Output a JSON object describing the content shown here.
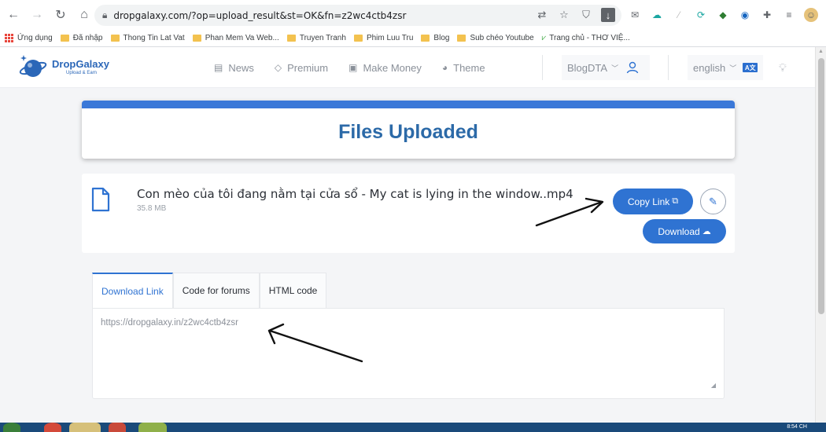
{
  "browser": {
    "url": "dropgalaxy.com/?op=upload_result&st=OK&fn=z2wc4ctb4zsr",
    "bookmarks": [
      {
        "label": "Ứng dụng",
        "kind": "apps"
      },
      {
        "label": "Đã nhập",
        "kind": "folder"
      },
      {
        "label": "Thong Tin Lat Vat",
        "kind": "folder"
      },
      {
        "label": "Phan Mem Va Web...",
        "kind": "folder"
      },
      {
        "label": "Truyen Tranh",
        "kind": "folder"
      },
      {
        "label": "Phim Luu Tru",
        "kind": "folder"
      },
      {
        "label": "Blog",
        "kind": "folder"
      },
      {
        "label": "Sub chéo Youtube",
        "kind": "folder"
      },
      {
        "label": "Trang chủ - THƠ VIỆ...",
        "kind": "page"
      }
    ]
  },
  "site": {
    "logo_title": "DropGalaxy",
    "logo_sub": "Upload & Earn",
    "nav": [
      {
        "label": "News",
        "icon": "newspaper-icon",
        "glyph": "▤"
      },
      {
        "label": "Premium",
        "icon": "diamond-icon",
        "glyph": "◇"
      },
      {
        "label": "Make Money",
        "icon": "money-icon",
        "glyph": "▣"
      },
      {
        "label": "Theme",
        "icon": "palette-icon",
        "glyph": "◕"
      }
    ],
    "user": "BlogDTA",
    "language": "english",
    "lang_badge": "A文"
  },
  "content": {
    "title": "Files Uploaded",
    "file_name": "Con mèo của tôi đang nằm tại cửa sổ - My cat is lying in the window..mp4",
    "file_size": "35.8 MB",
    "copy_label": "Copy Link",
    "download_label": "Download",
    "tabs": [
      "Download Link",
      "Code for forums",
      "HTML code"
    ],
    "active_tab": 0,
    "download_link": "https://dropgalaxy.in/z2wc4ctb4zsr"
  },
  "taskbar": {
    "time": "8:54 CH"
  },
  "colors": {
    "accent": "#2f73d2",
    "title": "#2c6aa8",
    "arrow": "#111111"
  }
}
